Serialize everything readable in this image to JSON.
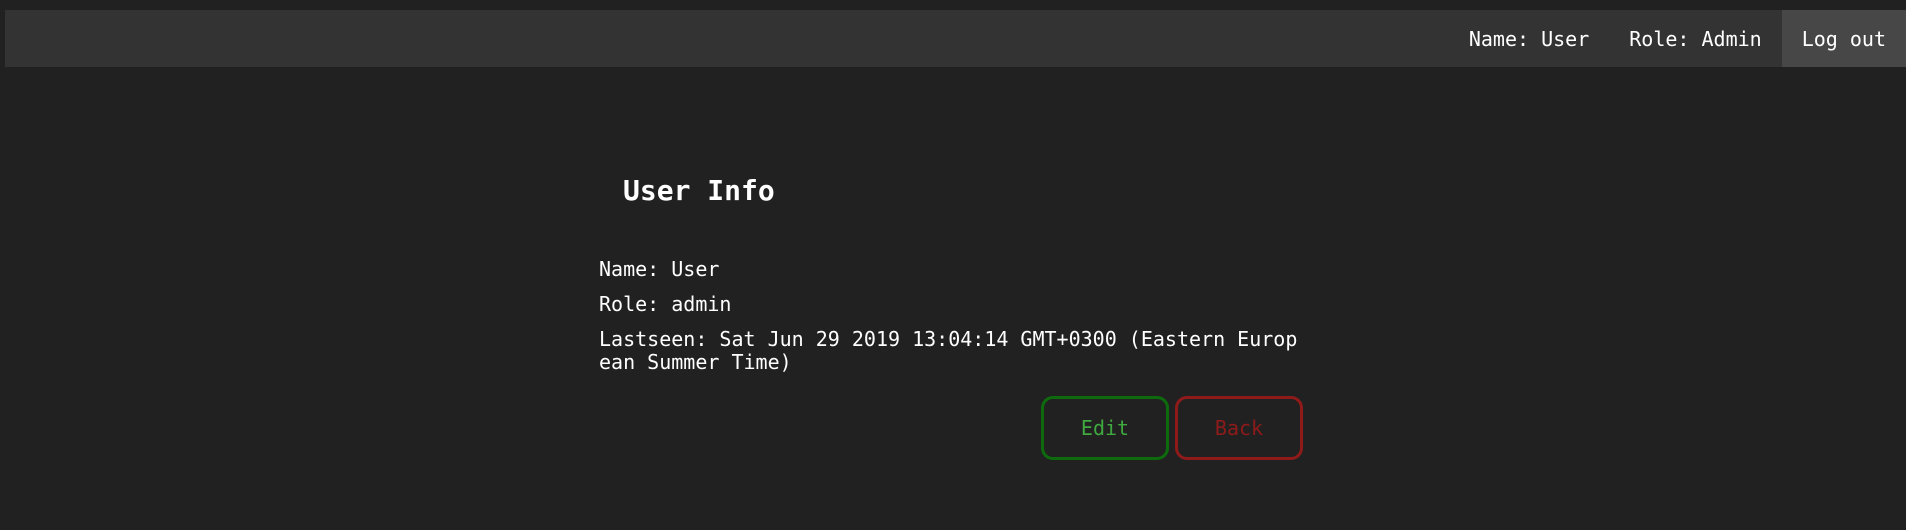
{
  "navbar": {
    "name_label": "Name: User",
    "role_label": "Role: Admin",
    "logout_label": "Log out"
  },
  "page": {
    "title": "User Info"
  },
  "user": {
    "name": "Name: User",
    "role": "Role: admin",
    "lastseen": "Lastseen: Sat Jun 29 2019 13:04:14 GMT+0300 (Eastern European Summer Time)"
  },
  "actions": {
    "edit_label": "Edit",
    "back_label": "Back"
  },
  "colors": {
    "background": "#212121",
    "navbar": "#333333",
    "logout_bg": "#474747",
    "edit_accent": "#3fa83f",
    "back_accent": "#8f1a1a"
  }
}
